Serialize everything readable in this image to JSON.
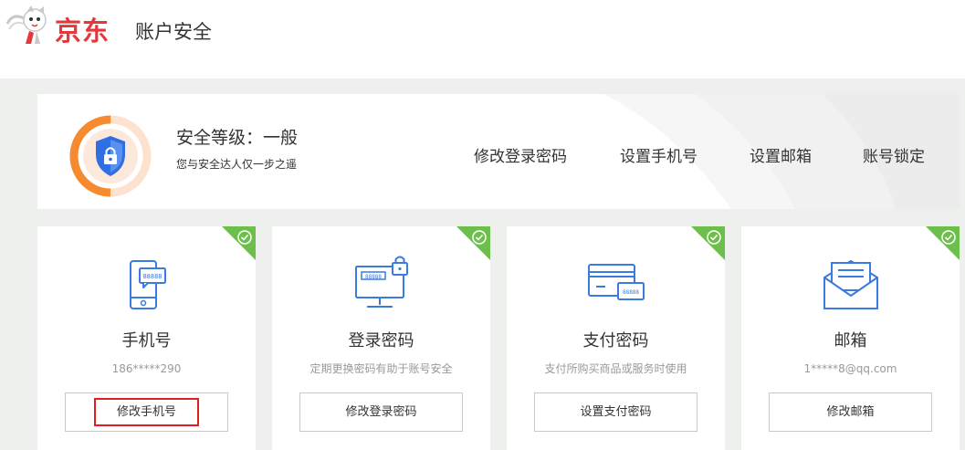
{
  "header": {
    "logo_text": "京东",
    "title": "账户安全"
  },
  "security": {
    "level_label": "安全等级：一般",
    "subtitle": "您与安全达人仅一步之遥",
    "level_fraction": 0.5,
    "links": [
      "修改登录密码",
      "设置手机号",
      "设置邮箱",
      "账号锁定"
    ]
  },
  "cards": [
    {
      "title": "手机号",
      "desc": "186*****290",
      "button": "修改手机号",
      "icon": "phone-message-icon",
      "verified": true
    },
    {
      "title": "登录密码",
      "desc": "定期更换密码有助于账号安全",
      "button": "修改登录密码",
      "icon": "monitor-lock-icon",
      "verified": true
    },
    {
      "title": "支付密码",
      "desc": "支付所购买商品或服务时使用",
      "button": "设置支付密码",
      "icon": "bank-cards-icon",
      "verified": true
    },
    {
      "title": "邮箱",
      "desc": "1*****8@qq.com",
      "button": "修改邮箱",
      "icon": "envelope-icon",
      "verified": true
    }
  ],
  "colors": {
    "brand_red": "#e4393c",
    "verified_green": "#6cbf4b",
    "icon_blue": "#3a7be0",
    "gauge_orange": "#f58a2e",
    "gauge_track": "#fde3cf",
    "highlight_red": "#e02020"
  }
}
